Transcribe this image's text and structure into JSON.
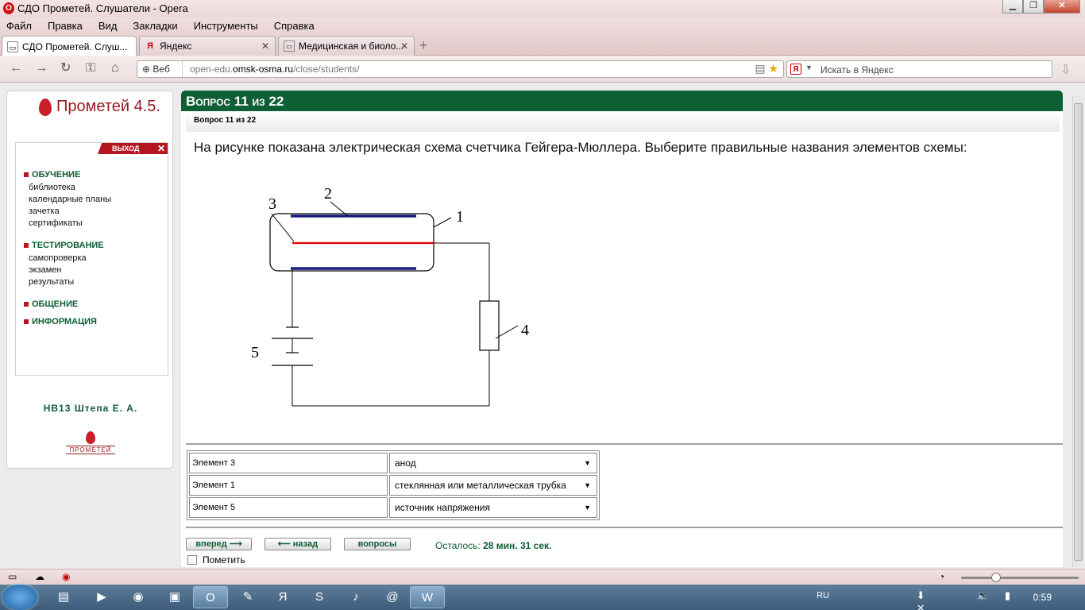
{
  "window": {
    "title": "СДО Прометей. Слушатели - Opera"
  },
  "menu": [
    "Файл",
    "Правка",
    "Вид",
    "Закладки",
    "Инструменты",
    "Справка"
  ],
  "tabs": [
    {
      "label": "СДО Прометей. Слуш...",
      "icon": "opera-page-icon"
    },
    {
      "label": "Яндекс",
      "icon": "yandex-icon"
    },
    {
      "label": "Медицинская и биоло...",
      "icon": "page-icon"
    }
  ],
  "address": {
    "web_label": "Веб",
    "url_prefix": "open-edu.",
    "url_host": "omsk-osma.ru",
    "url_path": "/close/students/"
  },
  "search": {
    "placeholder": "Искать в Яндекс",
    "engine_letter": "Я"
  },
  "sidebar": {
    "logo": "Прометей 4.5.",
    "exit": "ВЫХОД",
    "sections": [
      {
        "title": "ОБУЧЕНИЕ",
        "items": [
          "библиотека",
          "календарные планы",
          "зачетка",
          "сертификаты"
        ]
      },
      {
        "title": "ТЕСТИРОВАНИЕ",
        "items": [
          "самопроверка",
          "экзамен",
          "результаты"
        ]
      },
      {
        "title": "ОБЩЕНИЕ",
        "items": []
      },
      {
        "title": "ИНФОРМАЦИЯ",
        "items": []
      }
    ],
    "user": "НВ13 Штепа Е. А.",
    "bottom_logo": "ПРОМЕТЕЙ"
  },
  "question": {
    "header": "Вопрос 11 из 22",
    "sub": "Вопрос 11 из 22",
    "text": "На рисунке показана электрическая схема счетчика Гейгера-Мюллера. Выберите правильные названия элементов схемы:",
    "figure_labels": [
      "1",
      "2",
      "3",
      "4",
      "5"
    ],
    "answers": [
      {
        "label": "Элемент 3",
        "value": "анод"
      },
      {
        "label": "Элемент 1",
        "value": "стеклянная или металлическая трубка"
      },
      {
        "label": "Элемент 5",
        "value": "источник напряжения"
      }
    ]
  },
  "nav": {
    "forward": "вперед",
    "back": "назад",
    "questions": "вопросы"
  },
  "remaining": {
    "label": "Осталось:",
    "value": "28 мин. 31 сек."
  },
  "mark_label": "Пометить",
  "taskbar": {
    "lang": "RU",
    "time": "0:59"
  }
}
